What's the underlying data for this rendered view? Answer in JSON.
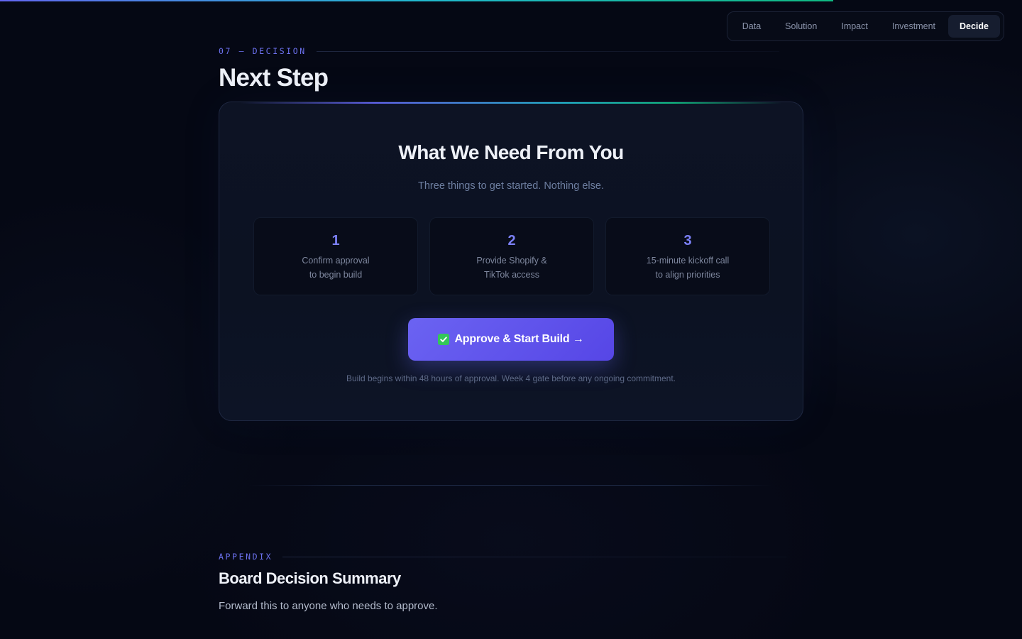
{
  "progress": {
    "fraction": 0.815
  },
  "nav": {
    "items": [
      {
        "label": "Data"
      },
      {
        "label": "Solution"
      },
      {
        "label": "Impact"
      },
      {
        "label": "Investment"
      },
      {
        "label": "Decide"
      }
    ],
    "active": "Decide"
  },
  "section": {
    "label": "07 — DECISION",
    "title": "Next Step"
  },
  "card": {
    "heading": "What We Need From You",
    "subheading": "Three things to get started. Nothing else.",
    "steps": [
      {
        "number": "1",
        "line1": "Confirm approval",
        "line2": "to begin build"
      },
      {
        "number": "2",
        "line1": "Provide Shopify &",
        "line2": "TikTok access"
      },
      {
        "number": "3",
        "line1": "15-minute kickoff call",
        "line2": "to align priorities"
      }
    ],
    "cta_label": "Approve & Start Build →",
    "cta_icon": "check-box-icon",
    "note": "Build begins within 48 hours of approval. Week 4 gate before any ongoing commitment."
  },
  "appendix": {
    "label": "APPENDIX",
    "title": "Board Decision Summary",
    "subtitle": "Forward this to anyone who needs to approve."
  },
  "colors": {
    "background": "#050814",
    "accent": "#6366f1",
    "accent_teal": "#22b8cf",
    "accent_green": "#10b981",
    "check": "#34c759"
  }
}
